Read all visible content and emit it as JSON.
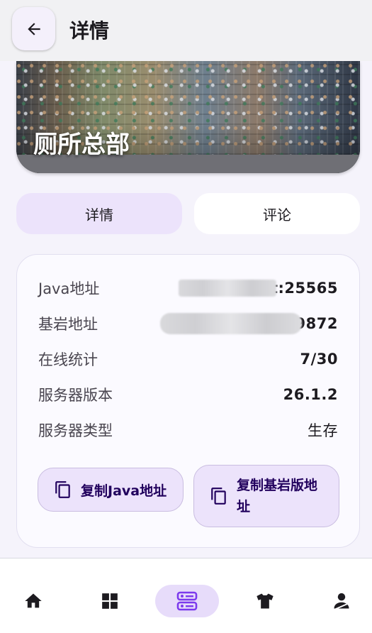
{
  "appbar": {
    "back_icon": "arrow-back-icon",
    "title": "详情"
  },
  "banner": {
    "server_name": "厕所总部"
  },
  "tabs": [
    {
      "label": "详情",
      "active": true
    },
    {
      "label": "评论",
      "active": false
    }
  ],
  "info": {
    "java_label": "Java地址",
    "java_value": "t:25565",
    "bedrock_label": "基岩地址",
    "bedrock_value": "9872",
    "online_label": "在线统计",
    "online_value": "7/30",
    "version_label": "服务器版本",
    "version_value": "26.1.2",
    "type_label": "服务器类型",
    "type_value": "生存"
  },
  "actions": {
    "copy_java": "复制Java地址",
    "copy_bedrock": "复制基岩版地址",
    "icon": "copy-icon"
  },
  "bottom_nav": [
    {
      "icon": "home-icon",
      "active": false
    },
    {
      "icon": "grid-icon",
      "active": false
    },
    {
      "icon": "server-icon",
      "active": true
    },
    {
      "icon": "shirt-icon",
      "active": false
    },
    {
      "icon": "user-icon",
      "active": false
    }
  ],
  "colors": {
    "accent": "#7c3aed",
    "tab_active_bg": "#ece3fb",
    "button_bg": "#ece3fb",
    "nav_active_bg": "#e7dcfa"
  }
}
